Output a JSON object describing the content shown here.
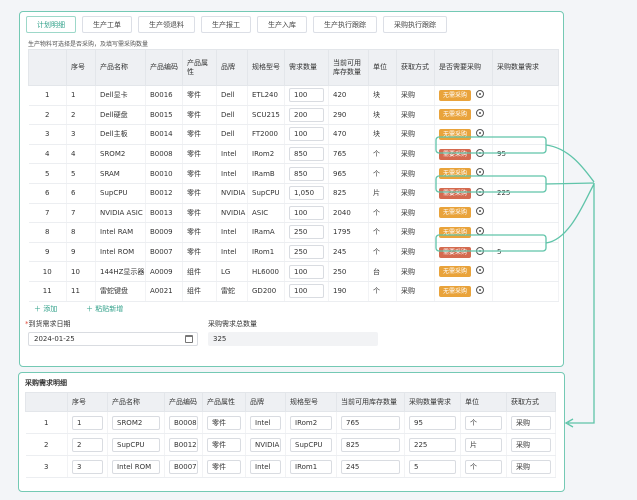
{
  "tabs": [
    "计划明细",
    "生产工单",
    "生产领退料",
    "生产报工",
    "生产入库",
    "生产执行跟踪",
    "采购执行跟踪"
  ],
  "note": "生产物料可选择是否采购，及填写需采购数量",
  "main_table": {
    "headers": [
      "",
      "序号",
      "产品名称",
      "产品编码",
      "产品属性",
      "品牌",
      "规格型号",
      "需求数量",
      "当前可用库存数量",
      "单位",
      "获取方式",
      "是否需要采购",
      "采购数量需求"
    ],
    "rows": [
      {
        "idx": "1",
        "seq": "1",
        "name": "Dell显卡",
        "code": "B0016",
        "attr": "零件",
        "brand": "Dell",
        "spec": "ETL240",
        "demand": "100",
        "stock": "420",
        "unit": "块",
        "method": "采购",
        "purchase": "无需采购",
        "qty": ""
      },
      {
        "idx": "2",
        "seq": "2",
        "name": "Dell硬盘",
        "code": "B0015",
        "attr": "零件",
        "brand": "Dell",
        "spec": "SCU215",
        "demand": "200",
        "stock": "290",
        "unit": "块",
        "method": "采购",
        "purchase": "无需采购",
        "qty": ""
      },
      {
        "idx": "3",
        "seq": "3",
        "name": "Dell主板",
        "code": "B0014",
        "attr": "零件",
        "brand": "Dell",
        "spec": "FT2000",
        "demand": "100",
        "stock": "470",
        "unit": "块",
        "method": "采购",
        "purchase": "无需采购",
        "qty": ""
      },
      {
        "idx": "4",
        "seq": "4",
        "name": "SROM2",
        "code": "B0008",
        "attr": "零件",
        "brand": "Intel",
        "spec": "IRom2",
        "demand": "850",
        "stock": "765",
        "unit": "个",
        "method": "采购",
        "purchase": "需要采购",
        "qty": "95"
      },
      {
        "idx": "5",
        "seq": "5",
        "name": "SRAM",
        "code": "B0010",
        "attr": "零件",
        "brand": "Intel",
        "spec": "IRamB",
        "demand": "850",
        "stock": "965",
        "unit": "个",
        "method": "采购",
        "purchase": "无需采购",
        "qty": ""
      },
      {
        "idx": "6",
        "seq": "6",
        "name": "SupCPU",
        "code": "B0012",
        "attr": "零件",
        "brand": "NVIDIA",
        "spec": "SupCPU",
        "demand": "1,050",
        "stock": "825",
        "unit": "片",
        "method": "采购",
        "purchase": "需要采购",
        "qty": "225"
      },
      {
        "idx": "7",
        "seq": "7",
        "name": "NVIDIA ASIC",
        "code": "B0013",
        "attr": "零件",
        "brand": "NVIDIA",
        "spec": "ASIC",
        "demand": "100",
        "stock": "2040",
        "unit": "个",
        "method": "采购",
        "purchase": "无需采购",
        "qty": ""
      },
      {
        "idx": "8",
        "seq": "8",
        "name": "Intel RAM",
        "code": "B0009",
        "attr": "零件",
        "brand": "Intel",
        "spec": "IRamA",
        "demand": "250",
        "stock": "1795",
        "unit": "个",
        "method": "采购",
        "purchase": "无需采购",
        "qty": ""
      },
      {
        "idx": "9",
        "seq": "9",
        "name": "Intel ROM",
        "code": "B0007",
        "attr": "零件",
        "brand": "Intel",
        "spec": "IRom1",
        "demand": "250",
        "stock": "245",
        "unit": "个",
        "method": "采购",
        "purchase": "需要采购",
        "qty": "5"
      },
      {
        "idx": "10",
        "seq": "10",
        "name": "144HZ显示器",
        "code": "A0009",
        "attr": "组件",
        "brand": "LG",
        "spec": "HL6000",
        "demand": "100",
        "stock": "250",
        "unit": "台",
        "method": "采购",
        "purchase": "无需采购",
        "qty": ""
      },
      {
        "idx": "11",
        "seq": "11",
        "name": "雷蛇键盘",
        "code": "A0021",
        "attr": "组件",
        "brand": "雷蛇",
        "spec": "GD200",
        "demand": "100",
        "stock": "190",
        "unit": "个",
        "method": "采购",
        "purchase": "无需采购",
        "qty": ""
      }
    ]
  },
  "actions": {
    "add": "＋ 添加",
    "paste": "＋ 粘贴新增"
  },
  "form": {
    "date_label": "到货需求日期",
    "date_value": "2024-01-25",
    "qty_label": "采购需求总数量",
    "qty_value": "325"
  },
  "detail": {
    "title": "采购需求明细",
    "headers": [
      "",
      "序号",
      "产品名称",
      "产品编码",
      "产品属性",
      "品牌",
      "规格型号",
      "当前可用库存数量",
      "采购数量需求",
      "单位",
      "获取方式"
    ],
    "rows": [
      {
        "idx": "1",
        "seq": "1",
        "name": "SROM2",
        "code": "B0008",
        "attr": "零件",
        "brand": "Intel",
        "spec": "IRom2",
        "stock": "765",
        "qty": "95",
        "unit": "个",
        "method": "采购"
      },
      {
        "idx": "2",
        "seq": "2",
        "name": "SupCPU",
        "code": "B0012",
        "attr": "零件",
        "brand": "NVIDIA",
        "spec": "SupCPU",
        "stock": "825",
        "qty": "225",
        "unit": "片",
        "method": "采购"
      },
      {
        "idx": "3",
        "seq": "3",
        "name": "Intel ROM",
        "code": "B0007",
        "attr": "零件",
        "brand": "Intel",
        "spec": "IRom1",
        "stock": "245",
        "qty": "5",
        "unit": "个",
        "method": "采购"
      }
    ]
  },
  "colors": {
    "accent": "#2fa089",
    "border": "#74c9b4",
    "need": "#d46a4f",
    "noneed": "#e9a33b"
  }
}
